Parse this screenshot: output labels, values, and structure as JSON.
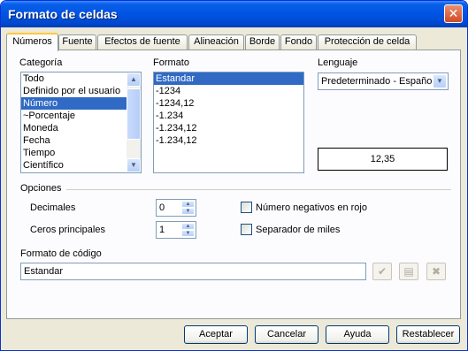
{
  "window": {
    "title": "Formato de celdas"
  },
  "tabs": [
    {
      "label": "Números",
      "active": true
    },
    {
      "label": "Fuente"
    },
    {
      "label": "Efectos de fuente"
    },
    {
      "label": "Alineación"
    },
    {
      "label": "Borde"
    },
    {
      "label": "Fondo"
    },
    {
      "label": "Protección de celda"
    }
  ],
  "categoria": {
    "label": "Categoría",
    "items": [
      "Todo",
      "Definido por el usuario",
      "Número",
      "~Porcentaje",
      "Moneda",
      "Fecha",
      "Tiempo",
      "Científico"
    ],
    "selected": "Número"
  },
  "formato": {
    "label": "Formato",
    "items": [
      "Estandar",
      "-1234",
      "-1234,12",
      "-1.234",
      "-1.234,12",
      "-1.234,12"
    ],
    "selected": "Estandar"
  },
  "lenguaje": {
    "label": "Lenguaje",
    "value": "Predeterminado - Español"
  },
  "preview": {
    "value": "12,35"
  },
  "opciones": {
    "label": "Opciones",
    "decimales_label": "Decimales",
    "decimales_value": "0",
    "ceros_label": "Ceros principales",
    "ceros_value": "1",
    "negativos_label": "Número negativos en rojo",
    "negativos_checked": false,
    "miles_label": "Separador de miles",
    "miles_checked": false
  },
  "codigo": {
    "label": "Formato de código",
    "value": "Estandar"
  },
  "icons": {
    "aceptar": "check-icon",
    "comentario": "comment-icon",
    "borrar": "delete-icon"
  },
  "buttons": {
    "ok": "Aceptar",
    "cancel": "Cancelar",
    "help": "Ayuda",
    "reset": "Restablecer"
  }
}
